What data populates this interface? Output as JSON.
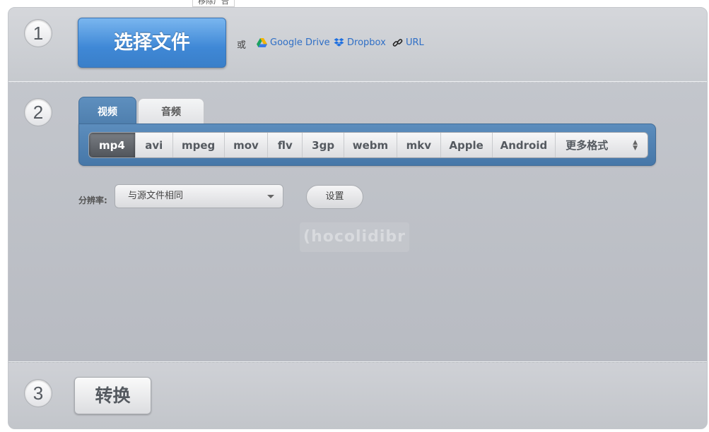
{
  "ad": {
    "remove_label": "移除广告"
  },
  "steps": {
    "one": "1",
    "two": "2",
    "three": "3"
  },
  "upload": {
    "choose_file_label": "选择文件",
    "or_label": "或",
    "sources": [
      {
        "label": "Google Drive",
        "icon": "google-drive-icon"
      },
      {
        "label": "Dropbox",
        "icon": "dropbox-icon"
      },
      {
        "label": "URL",
        "icon": "link-icon"
      }
    ]
  },
  "tabs": [
    {
      "label": "视频",
      "active": true
    },
    {
      "label": "音频",
      "active": false
    }
  ],
  "formats": [
    {
      "label": "mp4",
      "active": true
    },
    {
      "label": "avi"
    },
    {
      "label": "mpeg"
    },
    {
      "label": "mov"
    },
    {
      "label": "flv"
    },
    {
      "label": "3gp"
    },
    {
      "label": "webm"
    },
    {
      "label": "mkv"
    },
    {
      "label": "Apple"
    },
    {
      "label": "Android"
    },
    {
      "label": "更多格式"
    }
  ],
  "resolution": {
    "label": "分辨率:",
    "selected": "与源文件相同"
  },
  "settings_label": "设置",
  "watermark_text": "(hocolidibr",
  "convert_label": "转换",
  "colors": {
    "primary_blue": "#3f88d6",
    "tab_blue": "#4c7cab",
    "link_blue": "#2f6fc6"
  }
}
